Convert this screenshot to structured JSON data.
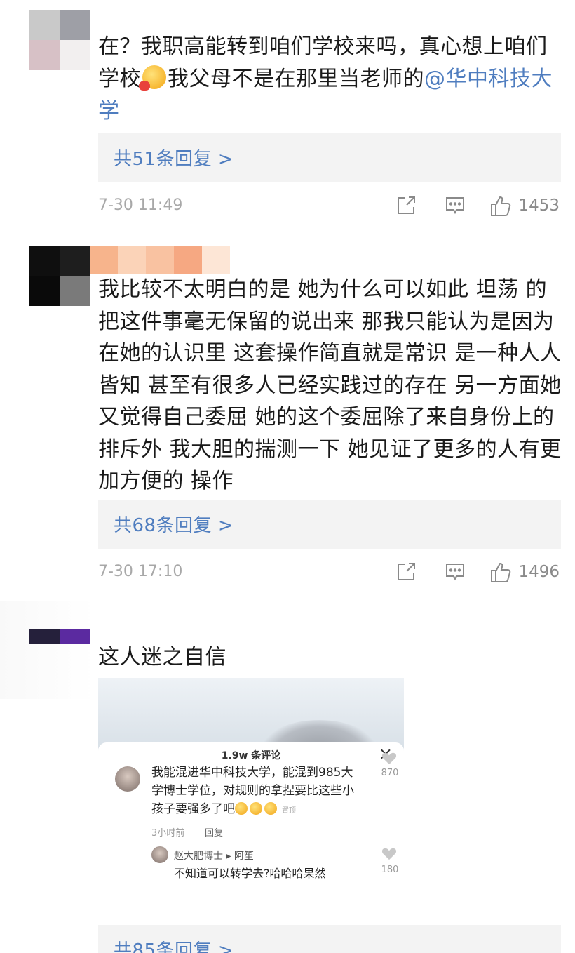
{
  "comments": [
    {
      "text_part1": "在？我职高能转到咱们学校来吗，真心想上咱们学校",
      "text_part2": "我父母不是在那里当老师的",
      "mention": "@华中科技大学",
      "reply_link": "共51条回复 >",
      "time": "7-30 11:49",
      "likes": "1453",
      "avatar_colors": [
        "#c9c9c9",
        "#9e9fa6",
        "#d7c1c6",
        "#f2efef"
      ]
    },
    {
      "text": "我比较不太明白的是 她为什么可以如此 坦荡 的把这件事毫无保留的说出来 那我只能认为是因为在她的认识里 这套操作简直就是常识 是一种人人皆知 甚至有很多人已经实践过的存在 另一方面她又觉得自己委屈 她的这个委屈除了来自身份上的排斥外 我大胆的揣测一下 她见证了更多的人有更加方便的 操作",
      "reply_link": "共68条回复 >",
      "time": "7-30 17:10",
      "likes": "1496",
      "avatar_colors": [
        "#0f0f0f",
        "#1e1e1e",
        "#0a0a0a",
        "#7a7a7a"
      ],
      "name_colors": [
        "#f7b48c",
        "#fbd3b8",
        "#f9c2a1",
        "#f6a882",
        "#fde6d6"
      ]
    },
    {
      "text": "这人迷之自信",
      "reply_link": "共85条回复 >",
      "avatar_colors": [
        "#25203b",
        "#5b2aa0",
        "#ffffff",
        "#ffffff"
      ],
      "embed": {
        "title": "1.9w 条评论",
        "close": "×",
        "c1_text": "我能混进华中科技大学，能混到985大学博士学位，对规则的拿捏要比这些小孩子要强多了吧",
        "c1_tag": "置顶",
        "c1_count": "870",
        "c1_time": "3小时前",
        "c1_reply": "回复",
        "c2_name": "赵大肥博士 ▸ 阿笙",
        "c2_text": "不知道可以转学去?哈哈哈果然",
        "c2_count": "180"
      }
    }
  ],
  "icons": [
    "share-icon",
    "comment-icon",
    "like-icon"
  ],
  "colors": {
    "link": "#4f7dbf",
    "meta": "#a8a8a8",
    "reply_bg": "#f3f3f3"
  }
}
